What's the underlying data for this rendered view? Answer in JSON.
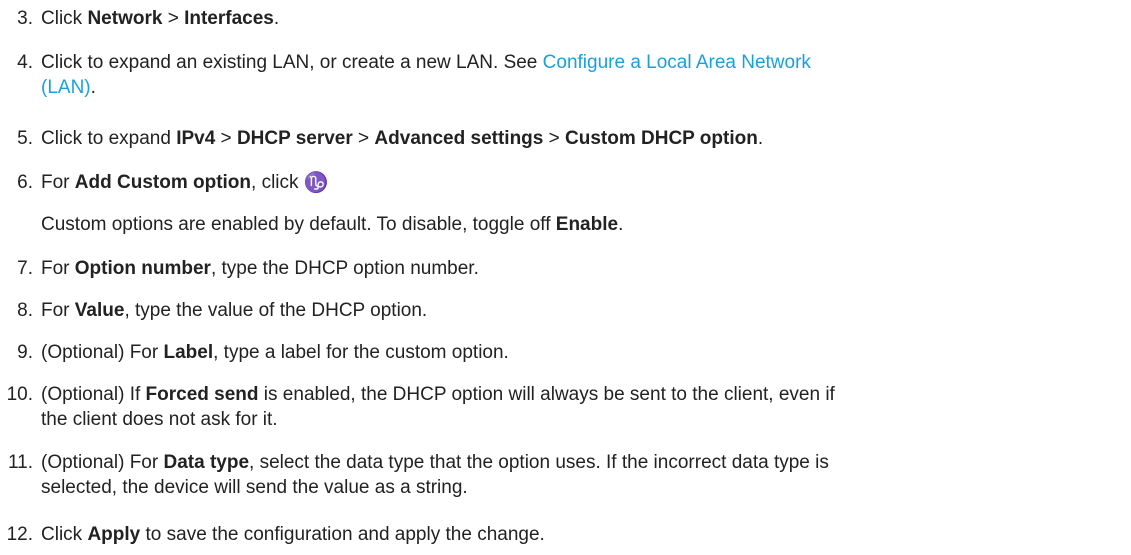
{
  "steps": [
    {
      "num": "3.",
      "t0": "Click ",
      "b0": "Network",
      "t1": " > ",
      "b1": "Interfaces",
      "t2": "."
    },
    {
      "num": "4.",
      "t0": "Click to expand an existing LAN, or create a new LAN. See ",
      "link_line1": "Configure a Local Area Network",
      "link_line2": "(LAN)",
      "t1": "."
    },
    {
      "num": "5.",
      "t0": "Click to expand ",
      "b0": "IPv4",
      "t1": " > ",
      "b1": "DHCP server",
      "t2": " > ",
      "b2": "Advanced settings",
      "t3": " > ",
      "b3": "Custom DHCP option",
      "t4": "."
    },
    {
      "num": "6.",
      "t0": "For ",
      "b0": "Add Custom option",
      "t1": ", click ",
      "icon": "♑",
      "icon_name": "add-icon",
      "note_t0": "Custom options are enabled by default. To disable, toggle off ",
      "note_b0": "Enable",
      "note_t1": "."
    },
    {
      "num": "7.",
      "t0": "For ",
      "b0": "Option number",
      "t1": ", type the DHCP option number."
    },
    {
      "num": "8.",
      "t0": "For ",
      "b0": "Value",
      "t1": ", type the value of the DHCP option."
    },
    {
      "num": "9.",
      "t0": "(Optional) For ",
      "b0": "Label",
      "t1": ", type a label for the custom option."
    },
    {
      "num": "10.",
      "t0": "(Optional) If ",
      "b0": "Forced send",
      "t1": " is enabled, the DHCP option will always be sent to the client, even if",
      "t2": "the client does not ask for it."
    },
    {
      "num": "11.",
      "t0": "(Optional) For ",
      "b0": "Data type",
      "t1": ", select the data type that the option uses. If the incorrect data type is",
      "t2": "selected, the device will send the value as a string."
    },
    {
      "num": "12.",
      "t0": "Click ",
      "b0": "Apply",
      "t1": " to save the configuration and apply the change."
    }
  ]
}
